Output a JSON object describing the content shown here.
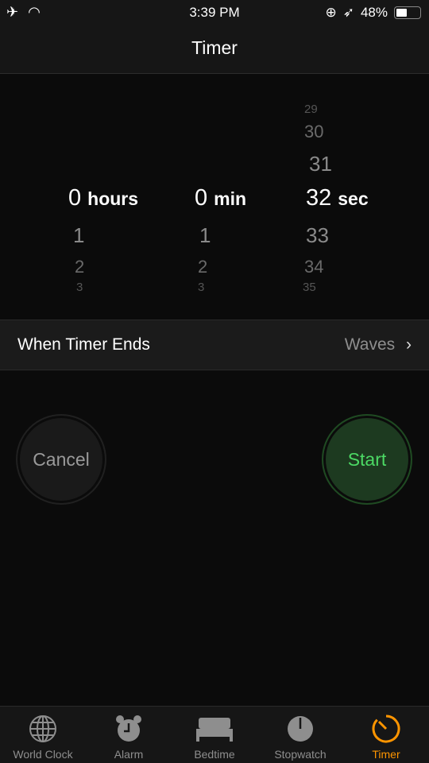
{
  "status": {
    "time": "3:39 PM",
    "battery": "48%",
    "battery_level": 0.48,
    "icons": [
      "airplane-icon",
      "wifi-icon",
      "orientation-lock-icon",
      "location-icon"
    ]
  },
  "nav": {
    "title": "Timer"
  },
  "picker": {
    "hours": {
      "above": [],
      "selected": "0",
      "unit": "hours",
      "below": [
        "1",
        "2",
        "3"
      ]
    },
    "minutes": {
      "above": [],
      "selected": "0",
      "unit": "min",
      "below": [
        "1",
        "2",
        "3"
      ]
    },
    "seconds": {
      "above": [
        "29",
        "30",
        "31"
      ],
      "selected": "32",
      "unit": "sec",
      "below": [
        "33",
        "34",
        "35"
      ]
    }
  },
  "when_ends": {
    "label": "When Timer Ends",
    "value": "Waves"
  },
  "buttons": {
    "cancel": "Cancel",
    "start": "Start"
  },
  "colors": {
    "accent": "#ff9500",
    "start": "#4cd964"
  },
  "tabs": [
    {
      "label": "World Clock",
      "icon": "globe-icon"
    },
    {
      "label": "Alarm",
      "icon": "alarm-clock-icon"
    },
    {
      "label": "Bedtime",
      "icon": "bed-icon"
    },
    {
      "label": "Stopwatch",
      "icon": "stopwatch-icon"
    },
    {
      "label": "Timer",
      "icon": "timer-icon",
      "active": true
    }
  ]
}
